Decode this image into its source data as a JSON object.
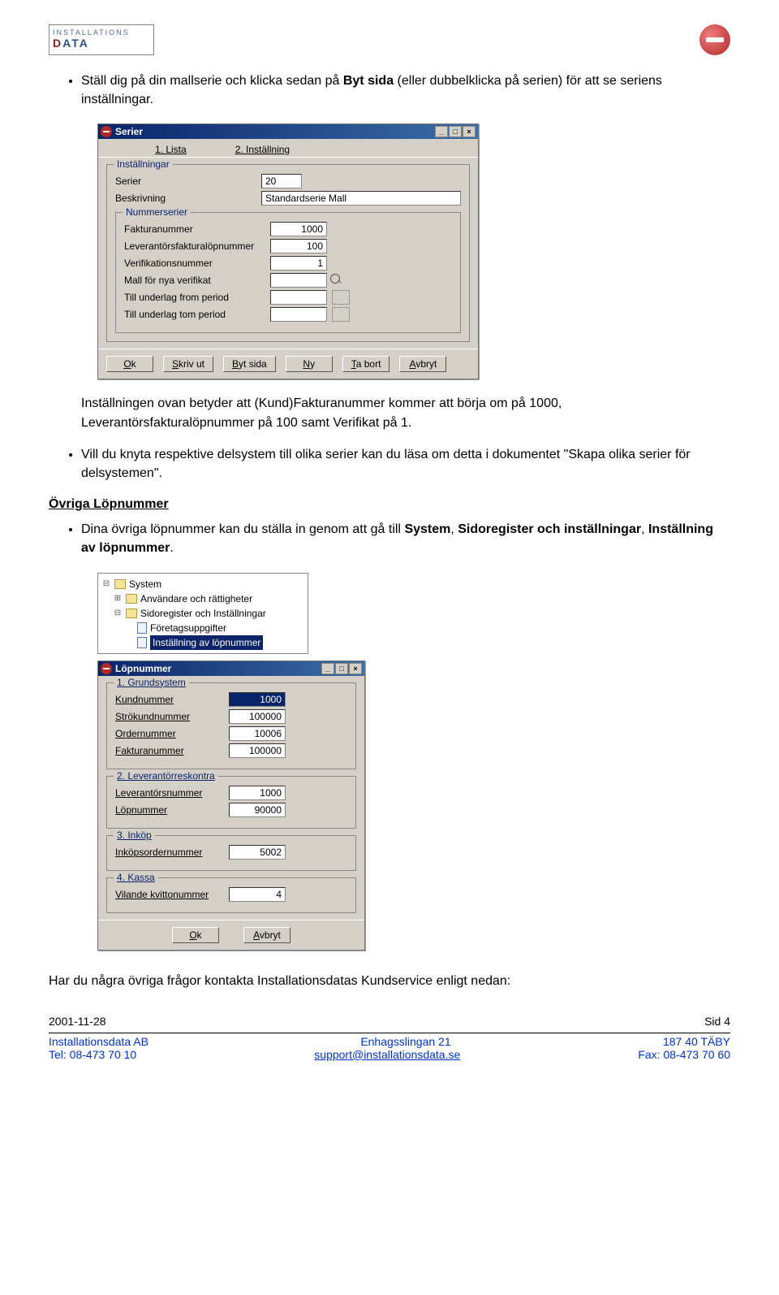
{
  "header": {
    "logo_top": "INSTALLATIONS",
    "logo_bottom": "DATA"
  },
  "bullet1_pre": "Ställ dig på din mallserie och klicka sedan på ",
  "bullet1_bold": "Byt sida",
  "bullet1_post": " (eller dubbelklicka på serien) för att se seriens inställningar.",
  "para2": "Inställningen ovan betyder att (Kund)Fakturanummer kommer att börja om på 1000, Leverantörsfakturalöpnummer på 100 samt Verifikat på 1.",
  "bullet3": "Vill du knyta respektive delsystem till olika serier kan du läsa om detta i dokumentet \"Skapa olika serier för delsystemen\".",
  "section2": "Övriga Löpnummer",
  "bullet4_pre": "Dina övriga löpnummer kan du ställa in genom att gå till ",
  "bullet4_b1": "System",
  "bullet4_mid": ", ",
  "bullet4_b2": "Sidoregister och inställningar",
  "bullet4_mid2": ", ",
  "bullet4_b3": "Inställning av löpnummer",
  "bullet4_post": ".",
  "win1": {
    "title": "Serier",
    "tab1": "1. Lista",
    "tab2": "2. Inställning",
    "group1": "Inställningar",
    "lbl_serier": "Serier",
    "val_serier": "20",
    "lbl_beskr": "Beskrivning",
    "val_beskr": "Standardserie Mall",
    "group2": "Nummerserier",
    "lbl_faktura": "Fakturanummer",
    "val_faktura": "1000",
    "lbl_levlop": "Leverantörsfakturalöpnummer",
    "val_levlop": "100",
    "lbl_verif": "Verifikationsnummer",
    "val_verif": "1",
    "lbl_mall": "Mall för nya verifikat",
    "lbl_from": "Till underlag from period",
    "lbl_tom": "Till underlag tom period",
    "btns": {
      "ok": "Ok",
      "skriv": "Skriv ut",
      "byt": "Byt sida",
      "ny": "Ny",
      "tabort": "Ta bort",
      "avbryt": "Avbryt"
    },
    "btns_labels": {
      "ok": "O",
      "skriv": "S",
      "byt": "B",
      "ny": "N",
      "tabort": "T",
      "avbryt": "A"
    }
  },
  "tree": {
    "n1": "System",
    "n2": "Användare och rättigheter",
    "n3": "Sidoregister och Inställningar",
    "n4": "Företagsuppgifter",
    "n5": "Inställning av löpnummer"
  },
  "win2": {
    "title": "Löpnummer",
    "g1": "1. Grundsystem",
    "lbl_kund": "Kundnummer",
    "val_kund": "1000",
    "lbl_strok": "Strökundnummer",
    "val_strok": "100000",
    "lbl_order": "Ordernummer",
    "val_order": "10006",
    "lbl_faktura": "Fakturanummer",
    "val_faktura": "100000",
    "g2": "2. Leverantörreskontra",
    "lbl_lev": "Leverantörsnummer",
    "val_lev": "1000",
    "lbl_lop": "Löpnummer",
    "val_lop": "90000",
    "g3": "3. Inköp",
    "lbl_inkop": "Inköpsordernummer",
    "val_inkop": "5002",
    "g4": "4. Kassa",
    "lbl_kvitto": "Vilande kvittonummer",
    "val_kvitto": "4",
    "btn_ok": "Ok",
    "btn_avbryt": "Avbryt"
  },
  "closing": "Har du några övriga frågor kontakta Installationsdatas Kundservice enligt nedan:",
  "footer": {
    "date": "2001-11-28",
    "page": "Sid 4",
    "company": "Installationsdata AB",
    "addr": "Enhagsslingan 21",
    "city": "187 40  TÄBY",
    "tel": "Tel: 08-473 70 10",
    "email": "support@installationsdata.se",
    "fax": "Fax: 08-473 70 60"
  }
}
